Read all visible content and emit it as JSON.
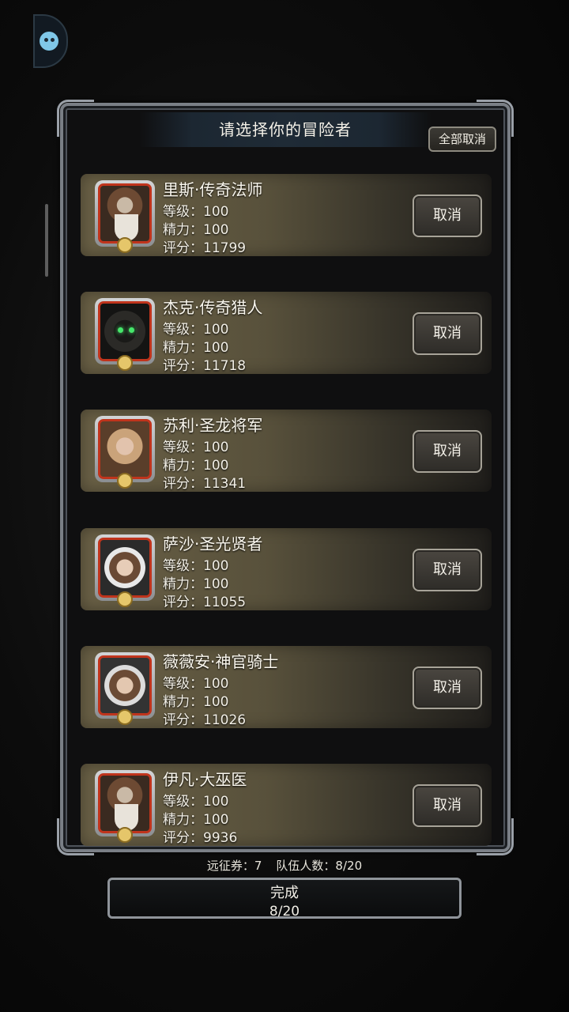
{
  "dialog": {
    "title": "请选择你的冒险者",
    "cancel_all_label": "全部取消"
  },
  "heroes": [
    {
      "name": "里斯·传奇法师",
      "level": "等级：100",
      "energy": "精力：100",
      "score": "评分：11799",
      "cancel_label": "取消"
    },
    {
      "name": "杰克·传奇猎人",
      "level": "等级：100",
      "energy": "精力：100",
      "score": "评分：11718",
      "cancel_label": "取消"
    },
    {
      "name": "苏利·圣龙将军",
      "level": "等级：100",
      "energy": "精力：100",
      "score": "评分：11341",
      "cancel_label": "取消"
    },
    {
      "name": "萨沙·圣光贤者",
      "level": "等级：100",
      "energy": "精力：100",
      "score": "评分：11055",
      "cancel_label": "取消"
    },
    {
      "name": "薇薇安·神官骑士",
      "level": "等级：100",
      "energy": "精力：100",
      "score": "评分：11026",
      "cancel_label": "取消"
    },
    {
      "name": "伊凡·大巫医",
      "level": "等级：100",
      "energy": "精力：100",
      "score": "评分：9936",
      "cancel_label": "取消"
    }
  ],
  "footer": {
    "tickets": "远征券：7",
    "team_count": "队伍人数：8/20",
    "finish_label": "完成",
    "finish_count": "8/20"
  }
}
